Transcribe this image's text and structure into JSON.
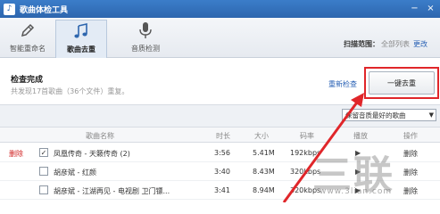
{
  "window": {
    "title": "歌曲体检工具",
    "min_symbol": "−",
    "close_symbol": "×"
  },
  "toolbar": {
    "tabs": [
      {
        "label": "智能重命名",
        "icon": "pencil-icon",
        "active": false
      },
      {
        "label": "歌曲去重",
        "icon": "music-note-icon",
        "active": true
      },
      {
        "label": "音质检测",
        "icon": "microphone-icon",
        "active": false
      }
    ],
    "scan": {
      "label": "扫描范围：",
      "value": "全部列表",
      "change": "更改"
    }
  },
  "status": {
    "title": "检查完成",
    "subtitle": "共发现17首歌曲（36个文件）重复。",
    "recheck": "重新检查",
    "dedup_button": "一键去重"
  },
  "filter": {
    "selected": "保留音质最好的歌曲"
  },
  "table": {
    "headers": {
      "name": "歌曲名称",
      "duration": "时长",
      "size": "大小",
      "bitrate": "码率",
      "play": "播放",
      "action": "操作"
    },
    "rows": [
      {
        "left_action": "删除",
        "checked": true,
        "checkmark": "✓",
        "name": "凤凰传奇 - 天籁传奇 (2)",
        "duration": "3:56",
        "size": "5.41M",
        "bitrate": "192kbps",
        "play": "▶",
        "action": "删除"
      },
      {
        "left_action": "",
        "checked": false,
        "checkmark": "",
        "name": "胡彦斌 - 红颜",
        "duration": "3:40",
        "size": "8.43M",
        "bitrate": "320kbps",
        "play": "▶",
        "action": "删除"
      },
      {
        "left_action": "",
        "checked": false,
        "checkmark": "",
        "name": "胡彦斌 - 江湖再见 - 电视剧 卫门镖...",
        "duration": "3:41",
        "size": "8.94M",
        "bitrate": "320kbps",
        "play": "▶",
        "action": "删除"
      }
    ]
  },
  "watermark": {
    "main": "三联",
    "sub": "www.3lian.com"
  },
  "colors": {
    "titlebar": "#2d66ae",
    "link": "#2a62b5",
    "delete": "#d02020",
    "highlight": "#e0262a"
  }
}
